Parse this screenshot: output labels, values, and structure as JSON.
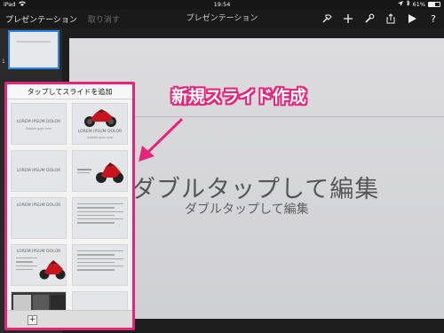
{
  "status_bar": {
    "device": "iPad",
    "time": "19:54",
    "battery_text": "61%",
    "battery_level": 0.61
  },
  "toolbar": {
    "presentations_label": "プレゼンテーション",
    "undo_label": "取り消す",
    "title": "プレゼンテーション",
    "icons": [
      "hammer-icon",
      "plus-icon",
      "wrench-icon",
      "share-icon",
      "play-icon",
      "help-icon"
    ],
    "help_label": "?"
  },
  "navigator": {
    "slides": [
      {
        "number": "1"
      }
    ]
  },
  "slide": {
    "title": "ダブルタップして編集",
    "subtitle": "ダブルタップして編集"
  },
  "annotation": {
    "text": "新規スライド作成",
    "color": "#e8237a"
  },
  "popover": {
    "header": "タップしてスライドを追加",
    "templates": [
      {
        "title": "LOREM IPSUM DOLOR",
        "subtitle": "Subtitle goes here"
      },
      {
        "title": "LOREM IPSUM DOLOR",
        "subtitle": "Subtitle goes here"
      },
      {
        "title": "LOREM IPSUM DOLOR",
        "subtitle": ""
      },
      {
        "title": "",
        "subtitle": ""
      },
      {
        "title": "LOREM IPSUM DOLOR",
        "subtitle": ""
      },
      {
        "title": "",
        "subtitle": ""
      },
      {
        "title": "LOREM IPSUM DOLOR",
        "subtitle": ""
      },
      {
        "title": "",
        "subtitle": ""
      }
    ],
    "add_label": "+"
  }
}
